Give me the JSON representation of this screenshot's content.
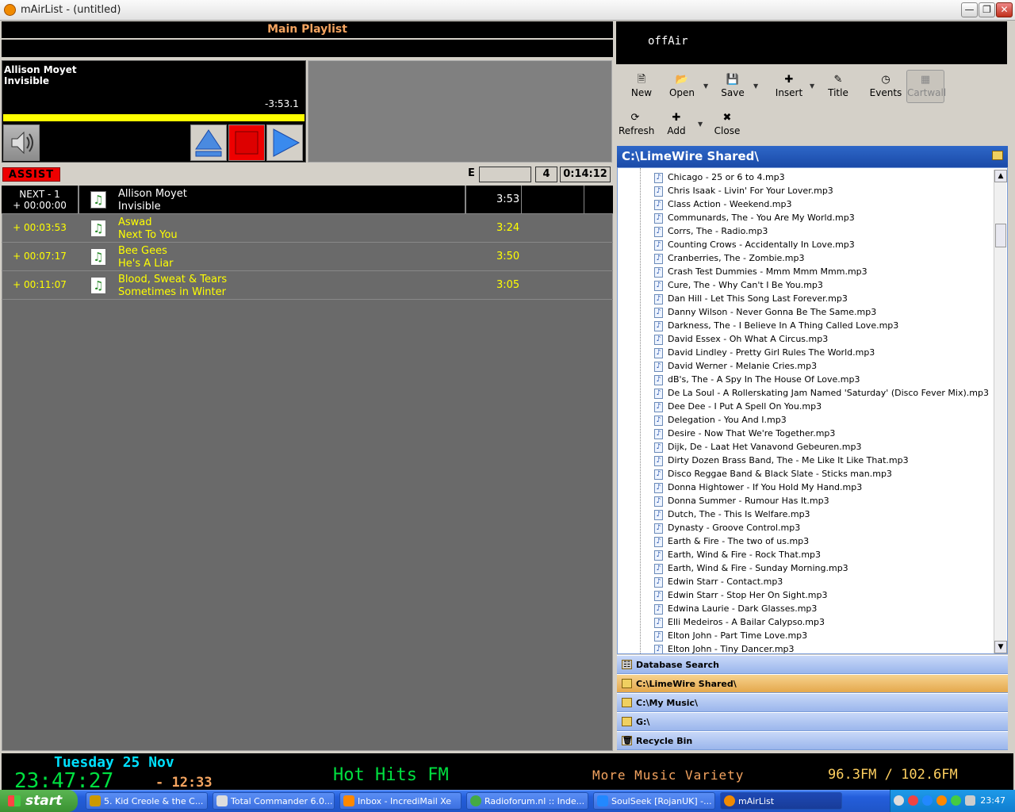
{
  "window": {
    "title": "mAirList - (untitled)",
    "min": "0",
    "max": "1",
    "close": "r"
  },
  "playlist": {
    "header": "Main Playlist",
    "player": {
      "artist": "Allison Moyet",
      "title": "Invisible",
      "remaining": "-3:53.1"
    },
    "assist_label": "ASSIST",
    "e_label": "E",
    "count": "4",
    "total": "0:14:12",
    "next_row": {
      "label": "NEXT - 1",
      "offset": "+ 00:00:00",
      "artist": "Allison Moyet",
      "title": "Invisible",
      "duration": "3:53"
    },
    "rows": [
      {
        "offset": "+ 00:03:53",
        "artist": "Aswad",
        "title": "Next To You",
        "duration": "3:24"
      },
      {
        "offset": "+ 00:07:17",
        "artist": "Bee Gees",
        "title": "He's A Liar",
        "duration": "3:50"
      },
      {
        "offset": "+ 00:11:07",
        "artist": "Blood, Sweat & Tears",
        "title": "Sometimes in Winter",
        "duration": "3:05"
      }
    ],
    "colors": {
      "active_text": "#ffff00",
      "assist": "#ee0000",
      "progress": "#ffff00"
    }
  },
  "onair": {
    "status": "offAir"
  },
  "toolbar": {
    "new": "New",
    "open": "Open",
    "save": "Save",
    "insert": "Insert",
    "title": "Title",
    "events": "Events",
    "cartwall": "Cartwall",
    "refresh": "Refresh",
    "add": "Add",
    "close": "Close"
  },
  "browser": {
    "path": "C:\\LimeWire Shared\\",
    "files": [
      "Chicago - 25 or 6 to 4.mp3",
      "Chris Isaak - Livin' For Your Lover.mp3",
      "Class Action - Weekend.mp3",
      "Communards, The - You Are My World.mp3",
      "Corrs, The - Radio.mp3",
      "Counting Crows - Accidentally In Love.mp3",
      "Cranberries, The - Zombie.mp3",
      "Crash Test Dummies - Mmm Mmm Mmm.mp3",
      "Cure, The - Why Can't I Be You.mp3",
      "Dan Hill - Let This Song Last Forever.mp3",
      "Danny Wilson - Never Gonna Be The Same.mp3",
      "Darkness, The - I Believe In A Thing Called Love.mp3",
      "David Essex - Oh What A Circus.mp3",
      "David Lindley - Pretty Girl Rules The World.mp3",
      "David Werner - Melanie Cries.mp3",
      "dB's, The - A Spy In The House Of Love.mp3",
      "De La Soul - A Rollerskating Jam Named 'Saturday' (Disco Fever Mix).mp3",
      "Dee Dee - I Put A Spell On You.mp3",
      "Delegation - You And I.mp3",
      "Desire - Now That We're Together.mp3",
      "Dijk, De - Laat Het Vanavond Gebeuren.mp3",
      "Dirty Dozen Brass Band, The - Me Like It Like That.mp3",
      "Disco Reggae Band & Black Slate - Sticks man.mp3",
      "Donna Hightower - If You Hold My Hand.mp3",
      "Donna Summer - Rumour Has It.mp3",
      "Dutch, The - This Is Welfare.mp3",
      "Dynasty - Groove Control.mp3",
      "Earth & Fire - The two of us.mp3",
      "Earth, Wind & Fire - Rock That.mp3",
      "Earth, Wind & Fire - Sunday Morning.mp3",
      "Edwin Starr - Contact.mp3",
      "Edwin Starr - Stop Her On Sight.mp3",
      "Edwina Laurie - Dark Glasses.mp3",
      "Elli Medeiros - A Bailar Calypso.mp3",
      "Elton John - Part Time Love.mp3",
      "Elton John - Tiny Dancer.mp3"
    ],
    "nav": [
      "Database Search",
      "C:\\LimeWire Shared\\",
      "C:\\My Music\\",
      "G:\\",
      "Recycle Bin"
    ]
  },
  "status": {
    "date": "Tuesday 25 Nov",
    "clock": "23:47:27",
    "remaining": "- 12:33",
    "station": "Hot Hits FM",
    "slogan": "More Music Variety",
    "frequency": "96.3FM / 102.6FM"
  },
  "taskbar": {
    "start": "start",
    "tasks": [
      "5. Kid Creole & the C...",
      "Total Commander 6.0...",
      "Inbox - IncrediMail Xe",
      "Radioforum.nl :: Inde...",
      "SoulSeek [RojanUK] -...",
      "mAirList"
    ],
    "time": "23:47"
  }
}
